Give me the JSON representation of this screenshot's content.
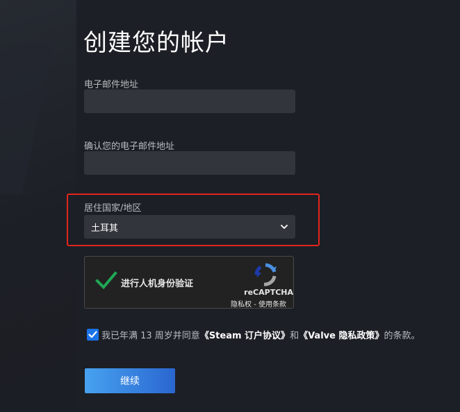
{
  "page": {
    "title": "创建您的帐户"
  },
  "form": {
    "email_label": "电子邮件地址",
    "email_value": "",
    "confirm_email_label": "确认您的电子邮件地址",
    "confirm_email_value": "",
    "country_label": "居住国家/地区",
    "country_selected": "土耳其"
  },
  "captcha": {
    "label": "进行人机身份验证",
    "brand": "reCAPTCHA",
    "privacy_link": "隐私权",
    "separator": " - ",
    "terms_link": "使用条款",
    "checked": true,
    "check_color": "#1fa855"
  },
  "agreement": {
    "checked": true,
    "text_before": "我已年满 13 周岁并同意",
    "steam_agreement": "《Steam 订户协议》",
    "text_and": "和",
    "valve_privacy": "《Valve 隐私政策》",
    "text_after": "的条款。"
  },
  "actions": {
    "continue_label": "继续"
  },
  "colors": {
    "background": "#1c1f25",
    "input_background": "#32353c",
    "highlight_border": "#e3251d",
    "button_gradient_start": "#47a2f0",
    "button_gradient_end": "#2a66d0",
    "checkbox_blue": "#1a73e8"
  }
}
